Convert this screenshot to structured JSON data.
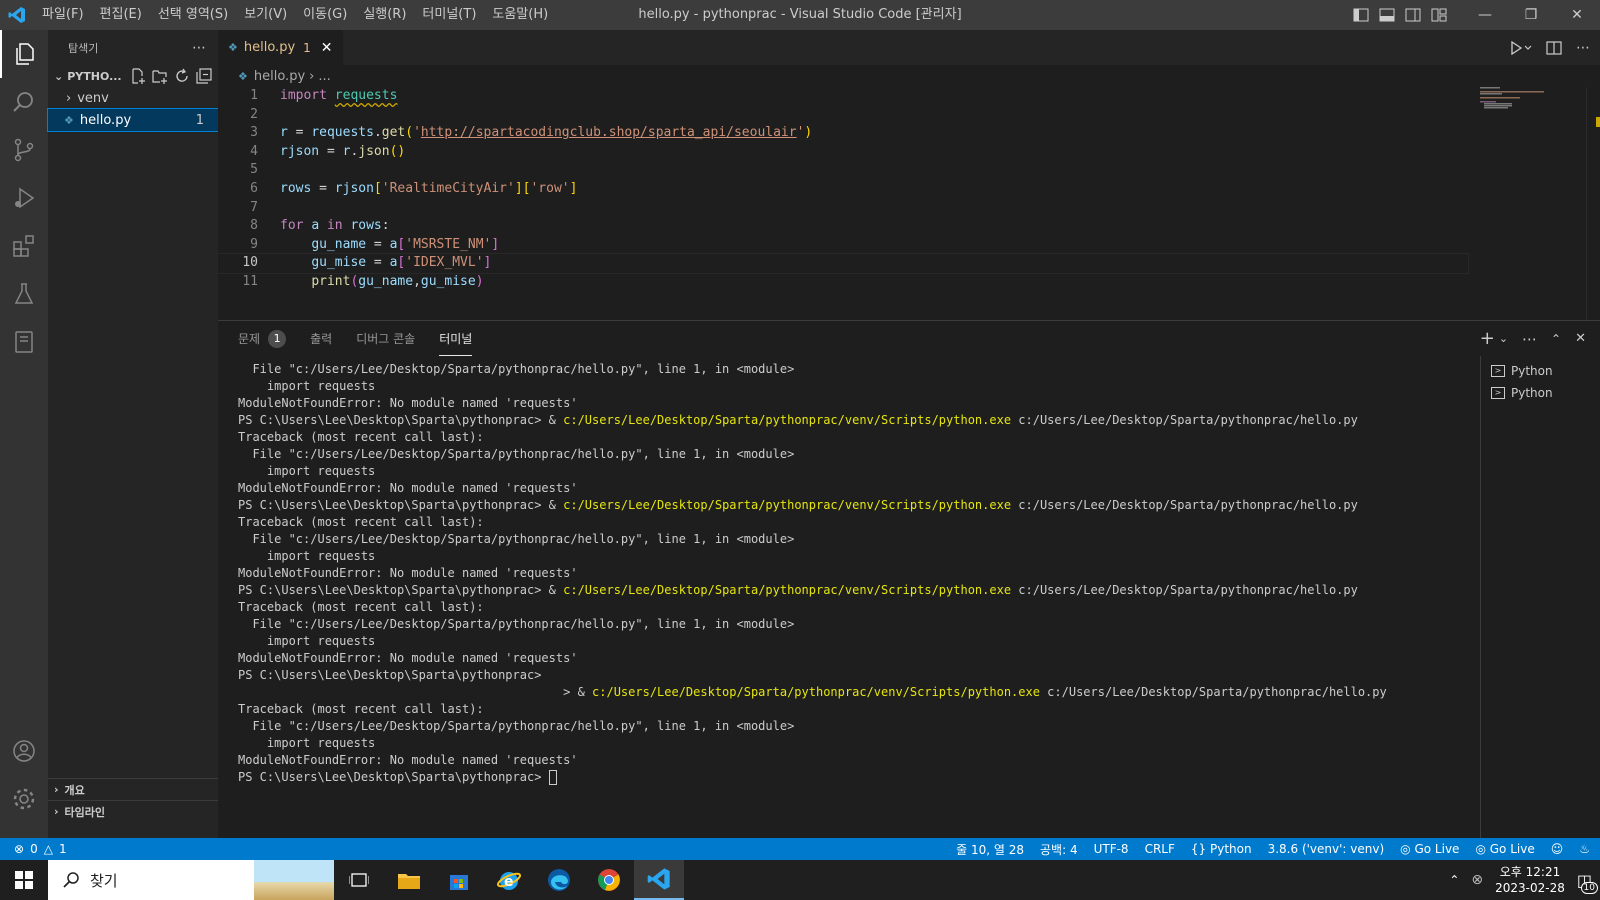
{
  "titlebar": {
    "menus": [
      "파일(F)",
      "편집(E)",
      "선택 영역(S)",
      "보기(V)",
      "이동(G)",
      "실행(R)",
      "터미널(T)",
      "도움말(H)"
    ],
    "window_title": "hello.py - pythonprac - Visual Studio Code [관리자]"
  },
  "sidebar": {
    "title": "탐색기",
    "folder": "PYTHO...",
    "items": [
      {
        "label": "venv",
        "type": "folder"
      },
      {
        "label": "hello.py",
        "type": "file",
        "badge": "1"
      }
    ],
    "sections": [
      "개요",
      "타임라인"
    ]
  },
  "editor": {
    "tab": {
      "label": "hello.py",
      "badge": "1"
    },
    "breadcrumb": {
      "file": "hello.py",
      "rest": "..."
    },
    "current_line": 10
  },
  "panel": {
    "tabs": [
      {
        "label": "문제",
        "badge": "1"
      },
      {
        "label": "출력"
      },
      {
        "label": "디버그 콘솔"
      },
      {
        "label": "터미널"
      }
    ],
    "terminal_list": [
      "Python",
      "Python"
    ],
    "terminal": {
      "file_line": "  File \"c:/Users/Lee/Desktop/Sparta/pythonprac/hello.py\", line 1, in <module>",
      "import_line": "    import requests",
      "error_line": "ModuleNotFoundError: No module named 'requests'",
      "prompt": "PS C:\\Users\\Lee\\Desktop\\Sparta\\pythonprac> ",
      "cmd_prefix": "& ",
      "python_path": "c:/Users/Lee/Desktop/Sparta/pythonprac/venv/Scripts/python.exe",
      "script_path": " c:/Users/Lee/Desktop/Sparta/pythonprac/hello.py",
      "traceback": "Traceback (most recent call last):",
      "wrapped_prefix": "                                             > "
    }
  },
  "statusbar": {
    "errors": "0",
    "warnings": "1",
    "position": "줄 10, 열 28",
    "spaces": "공백: 4",
    "encoding": "UTF-8",
    "eol": "CRLF",
    "language": "Python",
    "interpreter": "3.8.6 ('venv': venv)",
    "golive1": "Go Live",
    "golive2": "Go Live"
  },
  "taskbar": {
    "search_placeholder": "찾기",
    "time": "오후 12:21",
    "date": "2023-02-28",
    "notifications": "10"
  },
  "colors": {
    "accent": "#007acc",
    "activitybar": "#333333",
    "sidebar": "#252526",
    "editor": "#1e1e1e",
    "terminal_path": "#e5e510"
  }
}
